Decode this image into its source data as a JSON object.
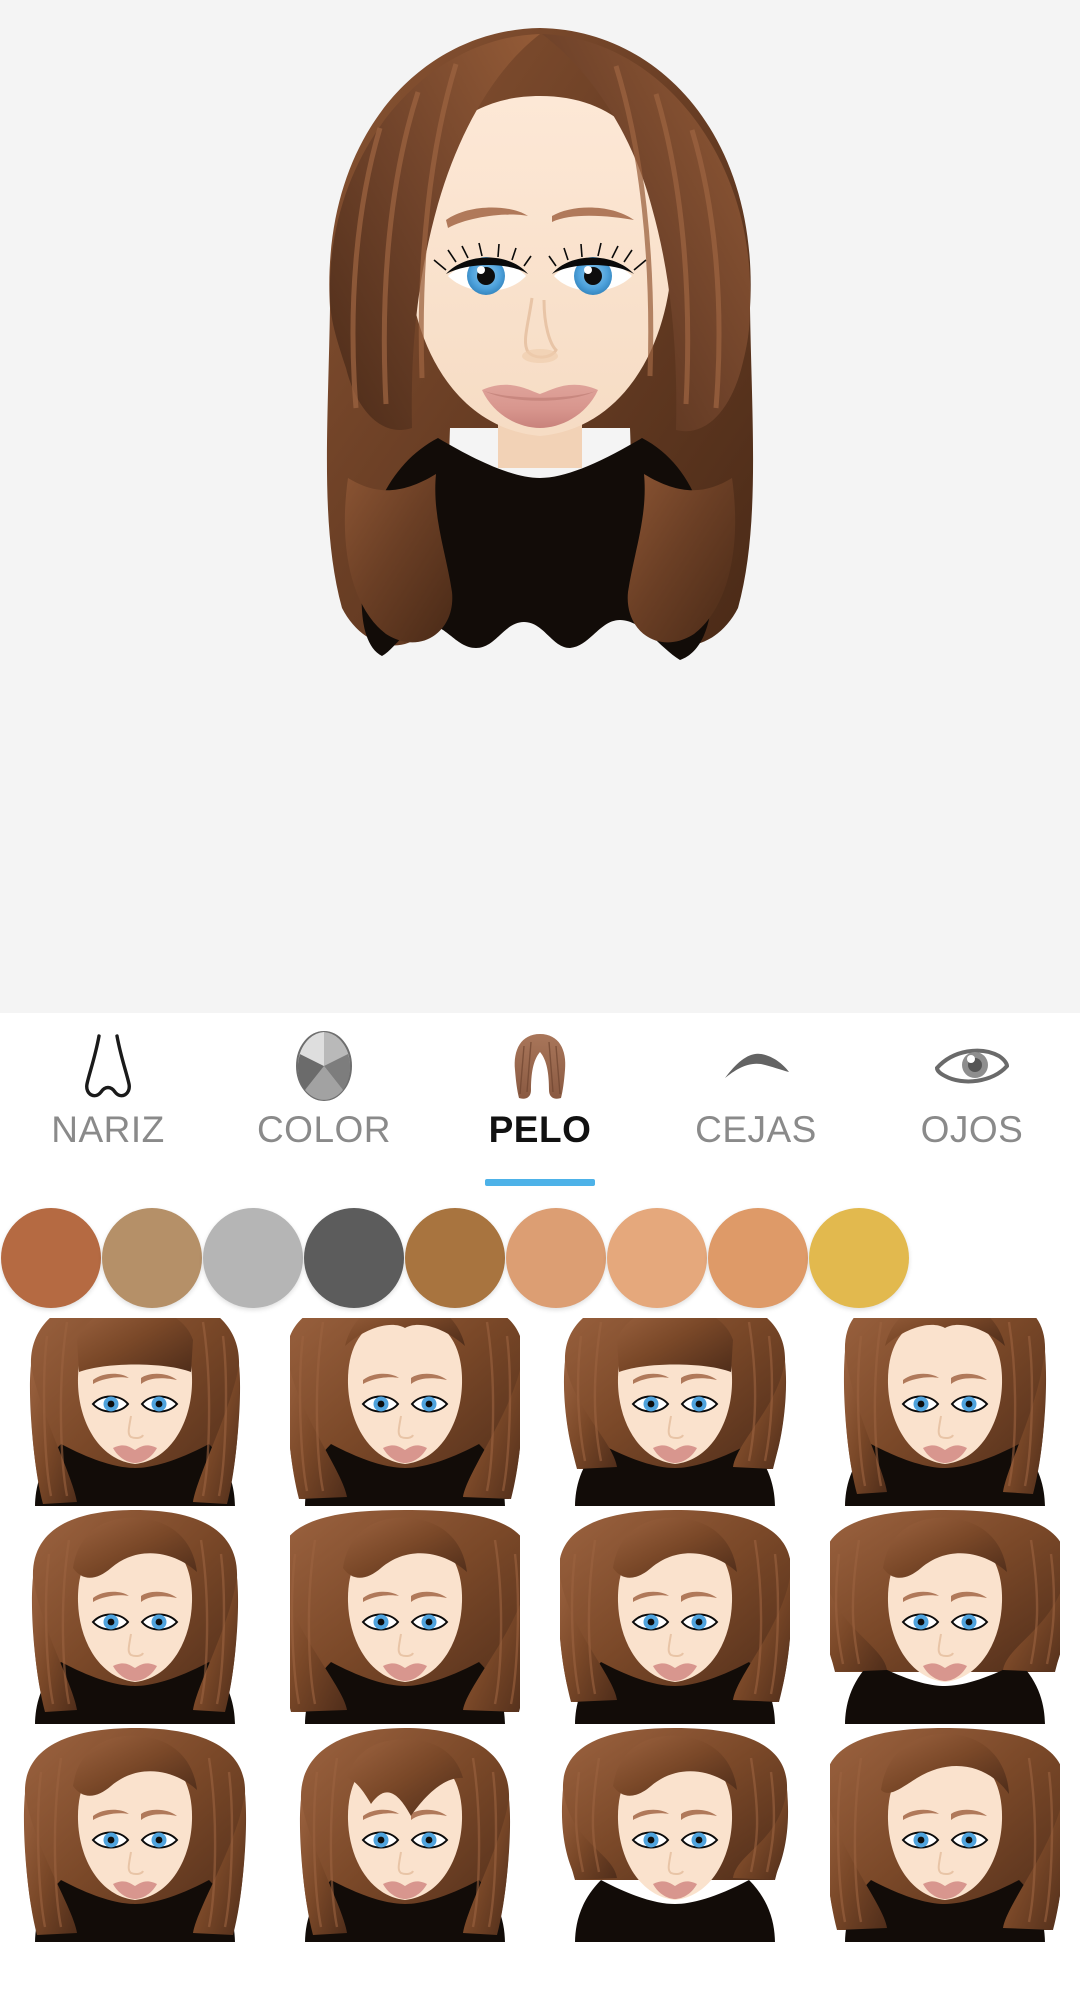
{
  "app": {
    "screen_name": "avatar-hair-editor",
    "preview_background": "#f4f4f4",
    "panel_background": "#ffffff",
    "accent_color": "#4db2e8",
    "active_tab_text_color": "#111111",
    "inactive_tab_text_color": "#8a8a8a"
  },
  "preview": {
    "avatar_name": "avatar-preview",
    "hair_color": "#6b3f25",
    "hair_highlight": "#8a5433",
    "skin_color": "#fae2cd",
    "eyebrow_color": "#b0795a",
    "eye_iris_color": "#4fa3dd",
    "lip_color": "#d8968e",
    "clothing_color": "#120c08"
  },
  "tabs": [
    {
      "label": "NARIZ",
      "icon": "nose-icon",
      "active": false
    },
    {
      "label": "COLOR",
      "icon": "color-wheel-icon",
      "active": false
    },
    {
      "label": "PELO",
      "icon": "hair-icon",
      "active": true
    },
    {
      "label": "CEJAS",
      "icon": "eyebrow-icon",
      "active": false
    },
    {
      "label": "OJOS",
      "icon": "eye-icon",
      "active": false
    }
  ],
  "color_swatches": [
    {
      "name": "swatch-sienna",
      "color": "#b56a42",
      "selected": false
    },
    {
      "name": "swatch-tan",
      "color": "#b59068",
      "selected": false
    },
    {
      "name": "swatch-light-gray",
      "color": "#b5b5b5",
      "selected": false
    },
    {
      "name": "swatch-dark-gray",
      "color": "#5c5c5c",
      "selected": false
    },
    {
      "name": "swatch-brown",
      "color": "#a8743f",
      "selected": false
    },
    {
      "name": "swatch-light-tan",
      "color": "#dc9e73",
      "selected": false
    },
    {
      "name": "swatch-peach",
      "color": "#e5a87c",
      "selected": false
    },
    {
      "name": "swatch-tan-orange",
      "color": "#de9a68",
      "selected": false
    },
    {
      "name": "swatch-yellow",
      "color": "#e2b94e",
      "selected": false
    }
  ],
  "hair_styles": [
    {
      "name": "hair-style-1",
      "style": "long-straight-blunt-bangs"
    },
    {
      "name": "hair-style-2",
      "style": "long-center-part-wavy"
    },
    {
      "name": "hair-style-3",
      "style": "medium-straight-full-bangs"
    },
    {
      "name": "hair-style-4",
      "style": "long-volume-center-part"
    },
    {
      "name": "hair-style-5",
      "style": "long-side-swept-bangs"
    },
    {
      "name": "hair-style-6",
      "style": "long-curly-voluminous"
    },
    {
      "name": "hair-style-7",
      "style": "medium-wavy-side-part"
    },
    {
      "name": "hair-style-8",
      "style": "short-curly-textured"
    },
    {
      "name": "hair-style-9",
      "style": "long-layered-side-part"
    },
    {
      "name": "hair-style-10",
      "style": "long-straight-wispy-bangs"
    },
    {
      "name": "hair-style-11",
      "style": "short-bob-side-volume"
    },
    {
      "name": "hair-style-12",
      "style": "long-swept-back-wavy"
    }
  ]
}
